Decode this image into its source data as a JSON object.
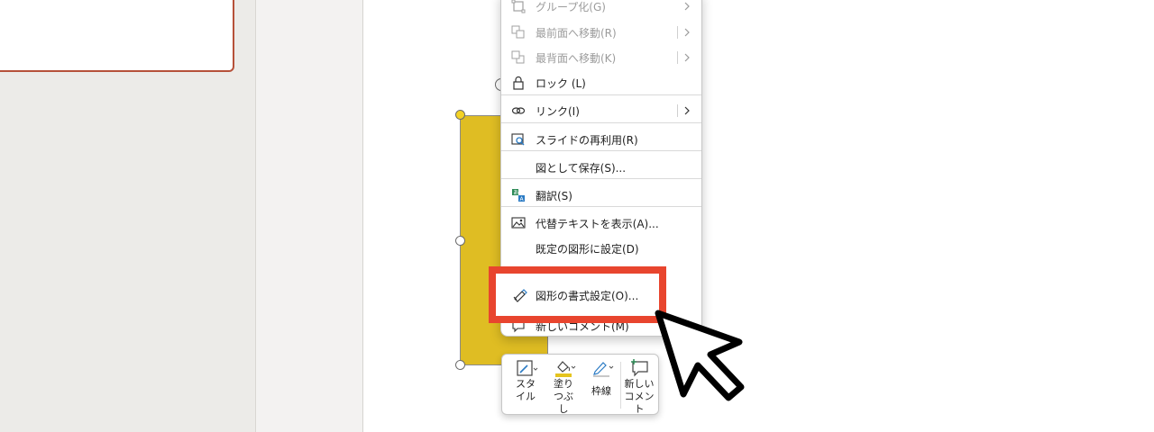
{
  "menu": {
    "items": [
      {
        "label": "グループ化(G)",
        "disabled": true,
        "submenu": true,
        "icon": "group-icon"
      },
      {
        "label": "最前面へ移動(R)",
        "disabled": true,
        "submenu": true,
        "icon": "bring-to-front-icon"
      },
      {
        "label": "最背面へ移動(K)",
        "disabled": true,
        "submenu": true,
        "icon": "send-to-back-icon"
      },
      {
        "label": "ロック (L)",
        "disabled": false,
        "submenu": false,
        "icon": "lock-icon"
      },
      {
        "label": "リンク(I)",
        "disabled": false,
        "submenu": true,
        "icon": "link-icon"
      },
      {
        "label": "スライドの再利用(R)",
        "disabled": false,
        "submenu": false,
        "icon": "reuse-slides-icon"
      },
      {
        "label": "図として保存(S)...",
        "disabled": false,
        "submenu": false,
        "icon": ""
      },
      {
        "label": "翻訳(S)",
        "disabled": false,
        "submenu": false,
        "icon": "translate-icon"
      },
      {
        "label": "代替テキストを表示(A)...",
        "disabled": false,
        "submenu": false,
        "icon": "alt-text-icon"
      },
      {
        "label": "既定の図形に設定(D)",
        "disabled": false,
        "submenu": false,
        "icon": ""
      },
      {
        "label": "新しいコメント(M)",
        "disabled": false,
        "submenu": false,
        "icon": "new-comment-icon"
      }
    ],
    "highlighted_item": {
      "label": "図形の書式設定(O)...",
      "icon": "format-shape-icon"
    }
  },
  "toolbar": {
    "style_label": "スタイル",
    "fill_label": "塗りつぶし",
    "outline_label": "枠線",
    "comment_label": "新しいコメント"
  },
  "colors": {
    "shape_fill": "#dfbd23",
    "highlight_border": "#e8452e",
    "thumbnail_border": "#b6513a",
    "fill_swatch": "#e5c41f"
  }
}
